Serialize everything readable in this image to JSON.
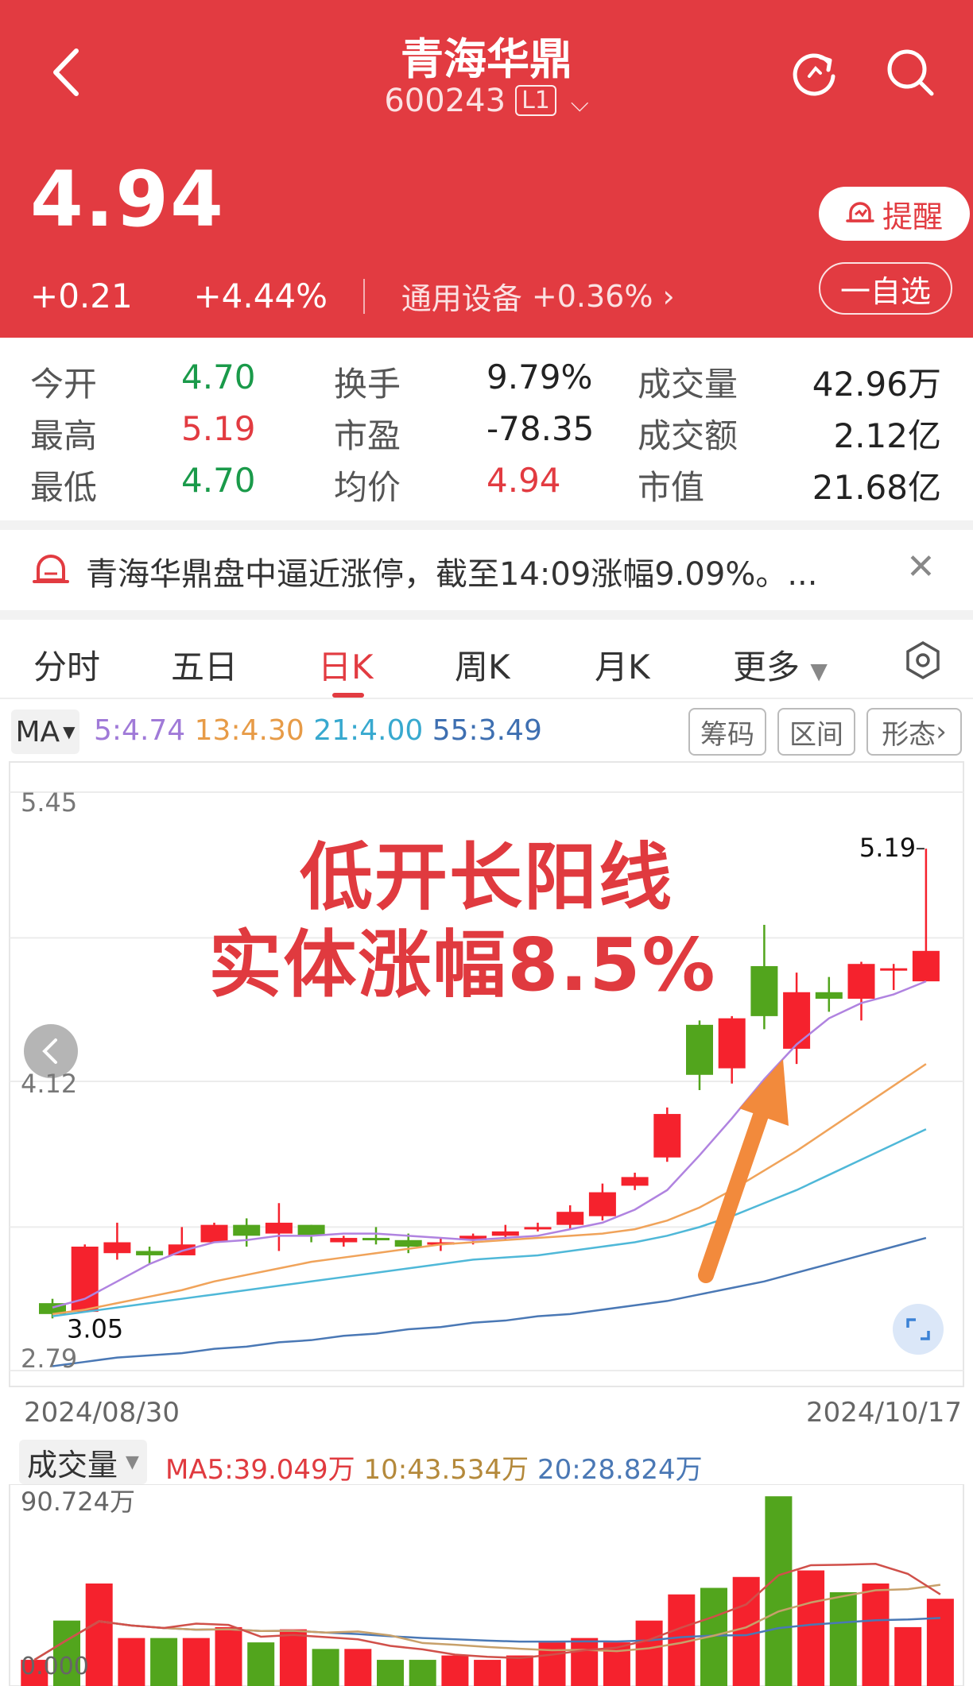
{
  "header": {
    "title": "青海华鼎",
    "code": "600243",
    "level": "L1",
    "price": "4.94",
    "change": "+0.21",
    "change_pct": "+4.44%",
    "industry": "通用设备",
    "industry_pct": "+0.36%",
    "alert_label": "提醒",
    "watchlist_label": "一自选"
  },
  "stats": [
    {
      "label": "今开",
      "value": "4.70",
      "color": "green"
    },
    {
      "label": "换手",
      "value": "9.79%",
      "color": "dark"
    },
    {
      "label": "成交量",
      "value": "42.96万",
      "color": "dark"
    },
    {
      "label": "最高",
      "value": "5.19",
      "color": "red"
    },
    {
      "label": "市盈",
      "value": "-78.35",
      "color": "dark"
    },
    {
      "label": "成交额",
      "value": "2.12亿",
      "color": "dark"
    },
    {
      "label": "最低",
      "value": "4.70",
      "color": "green"
    },
    {
      "label": "均价",
      "value": "4.94",
      "color": "red"
    },
    {
      "label": "市值",
      "value": "21.68亿",
      "color": "dark"
    }
  ],
  "news": {
    "text": "青海华鼎盘中逼近涨停，截至14:09涨幅9.09%。..."
  },
  "tabs": [
    "分时",
    "五日",
    "日K",
    "周K",
    "月K",
    "更多"
  ],
  "ma": {
    "selector": "MA",
    "ma5": "5:4.74",
    "ma13": "13:4.30",
    "ma21": "21:4.00",
    "ma55": "55:3.49",
    "buttons": [
      "筹码",
      "区间",
      "形态"
    ]
  },
  "overlay": {
    "line1": "低开长阳线",
    "line2": "实体涨幅8.5%"
  },
  "axis": {
    "ymax": "5.45",
    "ymid": "4.12",
    "ymin": "2.79",
    "high_label": "5.19",
    "low_label": "3.05",
    "date_start": "2024/08/30",
    "date_end": "2024/10/17"
  },
  "volume": {
    "selector": "成交量",
    "ma5": "MA5:39.049万",
    "ma10": "10:43.534万",
    "ma20": "20:28.824万",
    "max": "90.724万",
    "zero": "0.000"
  },
  "colors": {
    "up": "#f5222d",
    "down": "#52a51d",
    "ma5": "#b083e0",
    "ma13": "#f0a35a",
    "ma21": "#4fb8d8",
    "ma55": "#4a78b5",
    "header": "#e23b41"
  },
  "chart_data": {
    "type": "candlestick",
    "ylim": [
      2.79,
      5.45
    ],
    "candles": [
      {
        "o": 3.1,
        "c": 3.05,
        "h": 3.12,
        "l": 3.03
      },
      {
        "o": 3.06,
        "c": 3.36,
        "h": 3.37,
        "l": 3.06
      },
      {
        "o": 3.33,
        "c": 3.38,
        "h": 3.47,
        "l": 3.3
      },
      {
        "o": 3.34,
        "c": 3.32,
        "h": 3.36,
        "l": 3.28
      },
      {
        "o": 3.32,
        "c": 3.37,
        "h": 3.45,
        "l": 3.32
      },
      {
        "o": 3.38,
        "c": 3.46,
        "h": 3.47,
        "l": 3.38
      },
      {
        "o": 3.46,
        "c": 3.41,
        "h": 3.49,
        "l": 3.36
      },
      {
        "o": 3.42,
        "c": 3.47,
        "h": 3.56,
        "l": 3.34
      },
      {
        "o": 3.46,
        "c": 3.41,
        "h": 3.46,
        "l": 3.38
      },
      {
        "o": 3.38,
        "c": 3.4,
        "h": 3.41,
        "l": 3.36
      },
      {
        "o": 3.4,
        "c": 3.39,
        "h": 3.45,
        "l": 3.37
      },
      {
        "o": 3.39,
        "c": 3.36,
        "h": 3.42,
        "l": 3.33
      },
      {
        "o": 3.37,
        "c": 3.38,
        "h": 3.4,
        "l": 3.34
      },
      {
        "o": 3.39,
        "c": 3.41,
        "h": 3.42,
        "l": 3.37
      },
      {
        "o": 3.41,
        "c": 3.43,
        "h": 3.46,
        "l": 3.39
      },
      {
        "o": 3.44,
        "c": 3.45,
        "h": 3.47,
        "l": 3.43
      },
      {
        "o": 3.46,
        "c": 3.52,
        "h": 3.55,
        "l": 3.44
      },
      {
        "o": 3.5,
        "c": 3.61,
        "h": 3.65,
        "l": 3.48
      },
      {
        "o": 3.64,
        "c": 3.68,
        "h": 3.7,
        "l": 3.62
      },
      {
        "o": 3.77,
        "c": 3.97,
        "h": 4.0,
        "l": 3.75
      },
      {
        "o": 4.38,
        "c": 4.15,
        "h": 4.4,
        "l": 4.08
      },
      {
        "o": 4.18,
        "c": 4.41,
        "h": 4.42,
        "l": 4.11
      },
      {
        "o": 4.65,
        "c": 4.42,
        "h": 4.84,
        "l": 4.36
      },
      {
        "o": 4.27,
        "c": 4.53,
        "h": 4.62,
        "l": 4.2
      },
      {
        "o": 4.53,
        "c": 4.5,
        "h": 4.6,
        "l": 4.44
      },
      {
        "o": 4.5,
        "c": 4.66,
        "h": 4.67,
        "l": 4.4
      },
      {
        "o": 4.64,
        "c": 4.64,
        "h": 4.66,
        "l": 4.54
      },
      {
        "o": 4.58,
        "c": 4.72,
        "h": 5.19,
        "l": 4.58
      }
    ],
    "ma5_line": [
      3.08,
      3.12,
      3.2,
      3.28,
      3.34,
      3.38,
      3.39,
      3.41,
      3.41,
      3.42,
      3.42,
      3.41,
      3.4,
      3.39,
      3.4,
      3.41,
      3.44,
      3.47,
      3.53,
      3.62,
      3.78,
      3.95,
      4.13,
      4.29,
      4.41,
      4.48,
      4.52,
      4.58
    ],
    "ma13_line": [
      3.05,
      3.07,
      3.1,
      3.13,
      3.16,
      3.2,
      3.23,
      3.26,
      3.29,
      3.31,
      3.33,
      3.35,
      3.37,
      3.38,
      3.39,
      3.4,
      3.41,
      3.42,
      3.44,
      3.48,
      3.54,
      3.62,
      3.71,
      3.8,
      3.9,
      4.0,
      4.1,
      4.2
    ],
    "ma21_line": [
      3.04,
      3.06,
      3.08,
      3.1,
      3.12,
      3.14,
      3.16,
      3.18,
      3.2,
      3.22,
      3.24,
      3.26,
      3.28,
      3.3,
      3.31,
      3.32,
      3.34,
      3.36,
      3.38,
      3.41,
      3.45,
      3.5,
      3.56,
      3.62,
      3.69,
      3.76,
      3.83,
      3.9
    ],
    "ma55_line": [
      2.81,
      2.83,
      2.85,
      2.86,
      2.87,
      2.89,
      2.9,
      2.92,
      2.93,
      2.95,
      2.96,
      2.98,
      2.99,
      3.01,
      3.02,
      3.04,
      3.05,
      3.07,
      3.09,
      3.11,
      3.14,
      3.17,
      3.2,
      3.24,
      3.28,
      3.32,
      3.36,
      3.4
    ],
    "volume_max": 90.724,
    "volumes": [
      12,
      30,
      47,
      22,
      22,
      22,
      27,
      20,
      26,
      17,
      17,
      12,
      12,
      14,
      12,
      14,
      20,
      22,
      20,
      30,
      42,
      45,
      50,
      87,
      53,
      43,
      47,
      27,
      40
    ]
  }
}
